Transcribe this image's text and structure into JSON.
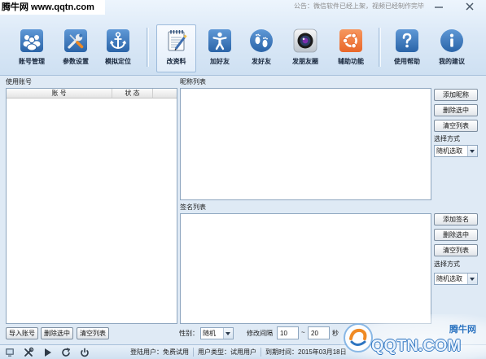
{
  "watermark_top": "腾牛网 www.qqtn.com",
  "notice": "公告：微信软件已经上架，视频已经制作完毕",
  "window_controls": {
    "minimize": "minimize-icon",
    "close": "close-icon"
  },
  "toolbar": {
    "items": [
      {
        "label": "账号管理",
        "icon": "users-icon"
      },
      {
        "label": "参数设置",
        "icon": "wrench-icon"
      },
      {
        "label": "模拟定位",
        "icon": "anchor-icon"
      },
      {
        "label": "改资料",
        "icon": "notepad-icon",
        "selected": true
      },
      {
        "label": "加好友",
        "icon": "person-icon"
      },
      {
        "label": "发好友",
        "icon": "footprints-icon"
      },
      {
        "label": "发朋友圈",
        "icon": "camera-icon"
      },
      {
        "label": "辅助功能",
        "icon": "ubuntu-icon"
      },
      {
        "label": "使用帮助",
        "icon": "help-icon"
      },
      {
        "label": "我的建议",
        "icon": "info-icon"
      }
    ]
  },
  "accounts": {
    "label": "使用账号",
    "columns": [
      "账 号",
      "状 态"
    ],
    "buttons": {
      "import": "导入账号",
      "delete": "删除选中",
      "clear": "清空列表"
    }
  },
  "nicknames": {
    "label": "昵称列表",
    "buttons": {
      "add": "添加昵称",
      "delete": "删除选中",
      "clear": "清空列表"
    },
    "mode_label": "选择方式",
    "mode_value": "随机选取"
  },
  "signatures": {
    "label": "签名列表",
    "buttons": {
      "add": "添加签名",
      "delete": "删除选中",
      "clear": "清空列表"
    },
    "mode_label": "选择方式",
    "mode_value": "随机选取"
  },
  "options": {
    "gender_label": "性别：",
    "gender_value": "随机",
    "interval_label": "修改间隔",
    "interval_min": "10",
    "interval_separator": "~",
    "interval_max": "20",
    "interval_unit": "秒"
  },
  "statusbar": {
    "icons": [
      "device-icon",
      "tools-icon",
      "play-icon",
      "refresh-icon",
      "power-icon"
    ],
    "login_user": "登陆用户：免费试用",
    "user_type": "用户类型：试用用户",
    "expiry": "到期时间：2015年03月18日"
  },
  "watermark": {
    "brand": "腾牛网",
    "site": "QQTN.COM"
  },
  "colors": {
    "background": "#dfeaf5",
    "icon_blue": "#2a64a8",
    "icon_orange": "#e9672a",
    "notice_text": "#8c8c8c"
  }
}
